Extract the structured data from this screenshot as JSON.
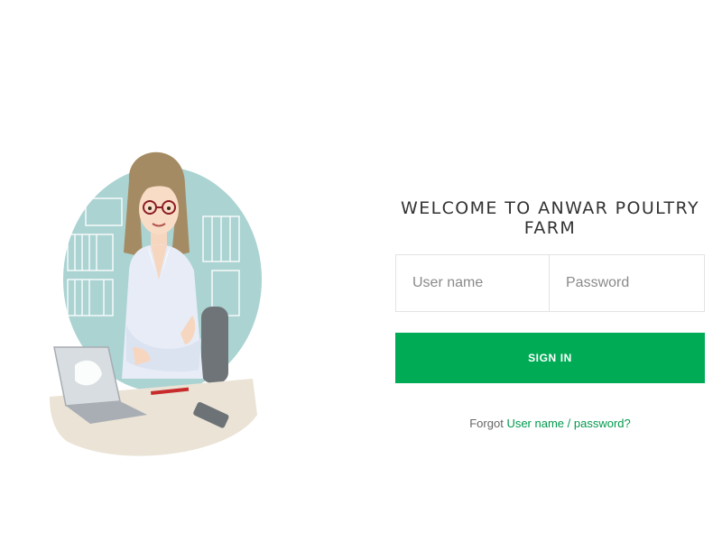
{
  "login": {
    "title": "WELCOME TO ANWAR POULTRY FARM",
    "username_placeholder": "User name",
    "password_placeholder": "Password",
    "signin_label": "SIGN IN",
    "forgot_prefix": "Forgot",
    "forgot_username": "User name",
    "forgot_separator": "/",
    "forgot_password": "password?"
  },
  "colors": {
    "accent": "#00ab55",
    "link": "#00994c",
    "illustration_bg": "#a9d2d1"
  },
  "illustration": {
    "icon": "woman-at-desk-illustration"
  }
}
